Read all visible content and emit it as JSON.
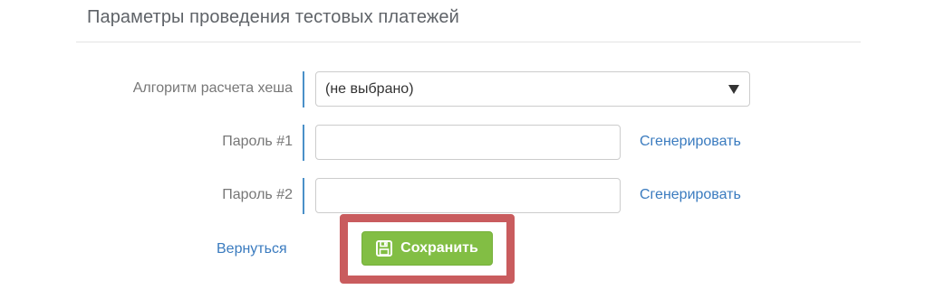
{
  "section": {
    "title": "Параметры проведения тестовых платежей"
  },
  "form": {
    "hash_algorithm": {
      "label": "Алгоритм расчета хеша",
      "selected_value": "(не выбрано)"
    },
    "password1": {
      "label": "Пароль #1",
      "value": "",
      "generate_label": "Сгенерировать"
    },
    "password2": {
      "label": "Пароль #2",
      "value": "",
      "generate_label": "Сгенерировать"
    }
  },
  "actions": {
    "back_label": "Вернуться",
    "save_label": "Сохранить",
    "save_icon": "floppy-disk-icon"
  },
  "colors": {
    "accent_link": "#3a7bbf",
    "label_bar": "#4a90c8",
    "save_button": "#82be44",
    "highlight_frame": "#c95c5e"
  }
}
